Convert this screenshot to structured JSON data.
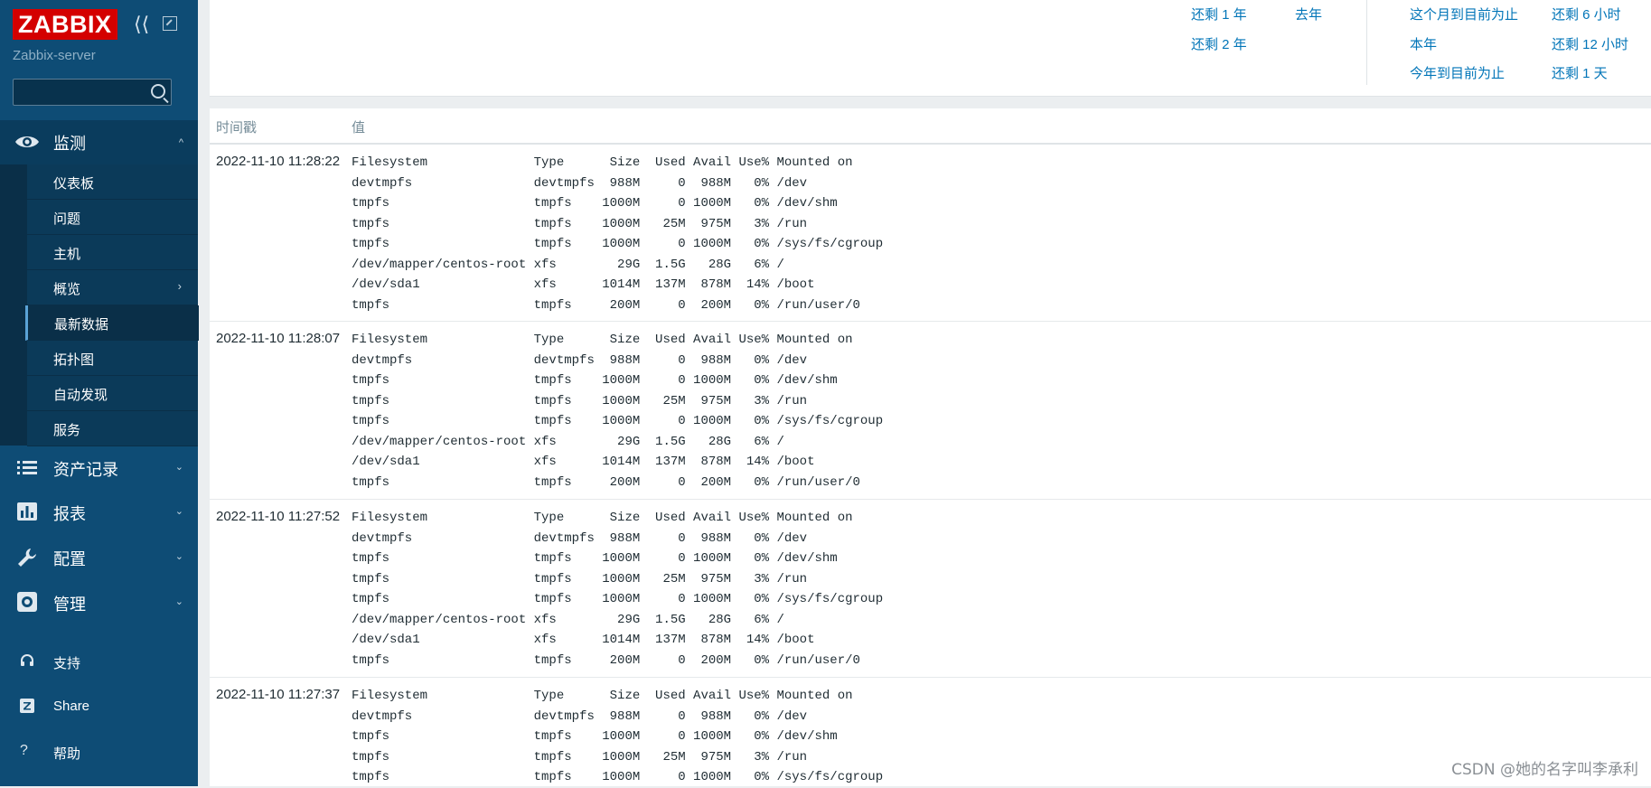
{
  "app": {
    "logo": "ZABBIX",
    "server_name": "Zabbix-server",
    "search_placeholder": ""
  },
  "sidebar": {
    "monitoring": {
      "label": "监测",
      "icon": "eye-icon"
    },
    "sub_items": [
      {
        "label": "仪表板"
      },
      {
        "label": "问题"
      },
      {
        "label": "主机"
      },
      {
        "label": "概览",
        "has_children": true
      },
      {
        "label": "最新数据",
        "active": true
      },
      {
        "label": "拓扑图"
      },
      {
        "label": "自动发现"
      },
      {
        "label": "服务"
      }
    ],
    "sections": [
      {
        "label": "资产记录",
        "icon": "list-icon"
      },
      {
        "label": "报表",
        "icon": "bar-chart-icon"
      },
      {
        "label": "配置",
        "icon": "wrench-icon"
      },
      {
        "label": "管理",
        "icon": "gear-icon"
      }
    ],
    "footer": [
      {
        "label": "支持",
        "icon": "headset-icon"
      },
      {
        "label": "Share",
        "icon": "share-icon"
      },
      {
        "label": "帮助",
        "icon": "help-icon"
      }
    ]
  },
  "time_filter": {
    "quick_links": [
      {
        "label": "还剩 1 年"
      },
      {
        "label": "去年"
      },
      {
        "label": "这个月到目前为止"
      },
      {
        "label": "还剩 6 小时"
      },
      {
        "label": "还剩 2 年"
      },
      {
        "label": "本年"
      },
      {
        "label": "还剩 12 小时"
      },
      {
        "label": "今年到目前为止"
      },
      {
        "label": "还剩 1 天"
      }
    ]
  },
  "table": {
    "headers": {
      "timestamp": "时间戳",
      "value": "值"
    },
    "rows": [
      {
        "timestamp": "2022-11-10 11:28:22",
        "value": "Filesystem              Type      Size  Used Avail Use% Mounted on\ndevtmpfs                devtmpfs  988M     0  988M   0% /dev\ntmpfs                   tmpfs    1000M     0 1000M   0% /dev/shm\ntmpfs                   tmpfs    1000M   25M  975M   3% /run\ntmpfs                   tmpfs    1000M     0 1000M   0% /sys/fs/cgroup\n/dev/mapper/centos-root xfs        29G  1.5G   28G   6% /\n/dev/sda1               xfs      1014M  137M  878M  14% /boot\ntmpfs                   tmpfs     200M     0  200M   0% /run/user/0"
      },
      {
        "timestamp": "2022-11-10 11:28:07",
        "value": "Filesystem              Type      Size  Used Avail Use% Mounted on\ndevtmpfs                devtmpfs  988M     0  988M   0% /dev\ntmpfs                   tmpfs    1000M     0 1000M   0% /dev/shm\ntmpfs                   tmpfs    1000M   25M  975M   3% /run\ntmpfs                   tmpfs    1000M     0 1000M   0% /sys/fs/cgroup\n/dev/mapper/centos-root xfs        29G  1.5G   28G   6% /\n/dev/sda1               xfs      1014M  137M  878M  14% /boot\ntmpfs                   tmpfs     200M     0  200M   0% /run/user/0"
      },
      {
        "timestamp": "2022-11-10 11:27:52",
        "value": "Filesystem              Type      Size  Used Avail Use% Mounted on\ndevtmpfs                devtmpfs  988M     0  988M   0% /dev\ntmpfs                   tmpfs    1000M     0 1000M   0% /dev/shm\ntmpfs                   tmpfs    1000M   25M  975M   3% /run\ntmpfs                   tmpfs    1000M     0 1000M   0% /sys/fs/cgroup\n/dev/mapper/centos-root xfs        29G  1.5G   28G   6% /\n/dev/sda1               xfs      1014M  137M  878M  14% /boot\ntmpfs                   tmpfs     200M     0  200M   0% /run/user/0"
      },
      {
        "timestamp": "2022-11-10 11:27:37",
        "value": "Filesystem              Type      Size  Used Avail Use% Mounted on\ndevtmpfs                devtmpfs  988M     0  988M   0% /dev\ntmpfs                   tmpfs    1000M     0 1000M   0% /dev/shm\ntmpfs                   tmpfs    1000M   25M  975M   3% /run\ntmpfs                   tmpfs    1000M     0 1000M   0% /sys/fs/cgroup"
      }
    ]
  },
  "watermark": "CSDN @她的名字叫李承利",
  "colors": {
    "sidebar_bg": "#0e4c75",
    "logo_red": "#d40000",
    "link_blue": "#0275b8"
  }
}
